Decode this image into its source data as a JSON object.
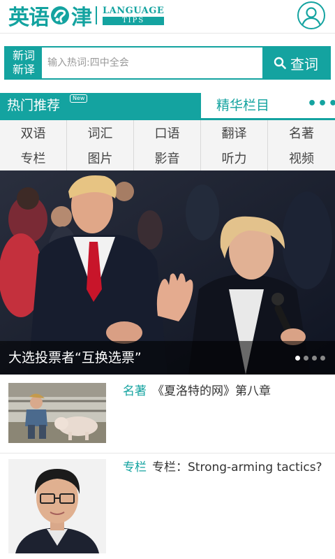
{
  "header": {
    "logo_cn_left": "英语",
    "logo_cn_right": "津",
    "logo_en_line1": "LANGUAGE",
    "logo_en_line2": "TIPS",
    "user_icon": "user-icon"
  },
  "search": {
    "badge": [
      "新词",
      "新译"
    ],
    "placeholder": "输入热词:四中全会",
    "value": "",
    "button_label": "查词",
    "icon": "search-icon"
  },
  "categories": {
    "hot_label": "热门推荐",
    "new_badge": "New",
    "featured_label": "精华栏目",
    "more_label": "•••",
    "items": [
      "双语",
      "词汇",
      "口语",
      "翻译",
      "名著",
      "专栏",
      "图片",
      "影音",
      "听力",
      "视频"
    ]
  },
  "hero": {
    "caption": "大选投票者“互换选票”",
    "slide_count": 4,
    "active_slide": 1
  },
  "articles": [
    {
      "category": "名著",
      "title": "《夏洛特的网》第八章"
    },
    {
      "category": "专栏",
      "title": "专栏：Strong-arming tactics?"
    }
  ],
  "colors": {
    "accent": "#14a3a0",
    "text": "#333333",
    "grid_bg": "#f4f4f4"
  }
}
